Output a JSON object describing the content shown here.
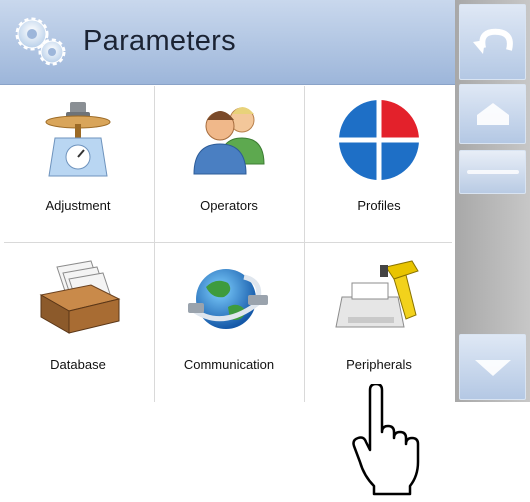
{
  "header": {
    "title": "Parameters",
    "icon": "gears-icon"
  },
  "tiles": [
    {
      "label": "Adjustment",
      "icon": "scale-icon"
    },
    {
      "label": "Operators",
      "icon": "operators-icon"
    },
    {
      "label": "Profiles",
      "icon": "profiles-icon"
    },
    {
      "label": "Database",
      "icon": "database-icon"
    },
    {
      "label": "Communication",
      "icon": "communication-icon"
    },
    {
      "label": "Peripherals",
      "icon": "peripherals-icon"
    }
  ],
  "sidebar": {
    "buttons": [
      {
        "name": "back",
        "icon": "undo-arrow-icon"
      },
      {
        "name": "home",
        "icon": "home-icon"
      },
      {
        "name": "scroll",
        "icon": "scroll-thumb"
      },
      {
        "name": "down",
        "icon": "arrow-down-icon"
      }
    ]
  },
  "pointer": {
    "icon": "hand-pointer-icon"
  },
  "colors": {
    "header": "#9db6da",
    "sidebar": "#b7b7b7",
    "button": "#c9d8ed",
    "profile_red": "#e3212b",
    "profile_blue": "#1e6fc6"
  }
}
